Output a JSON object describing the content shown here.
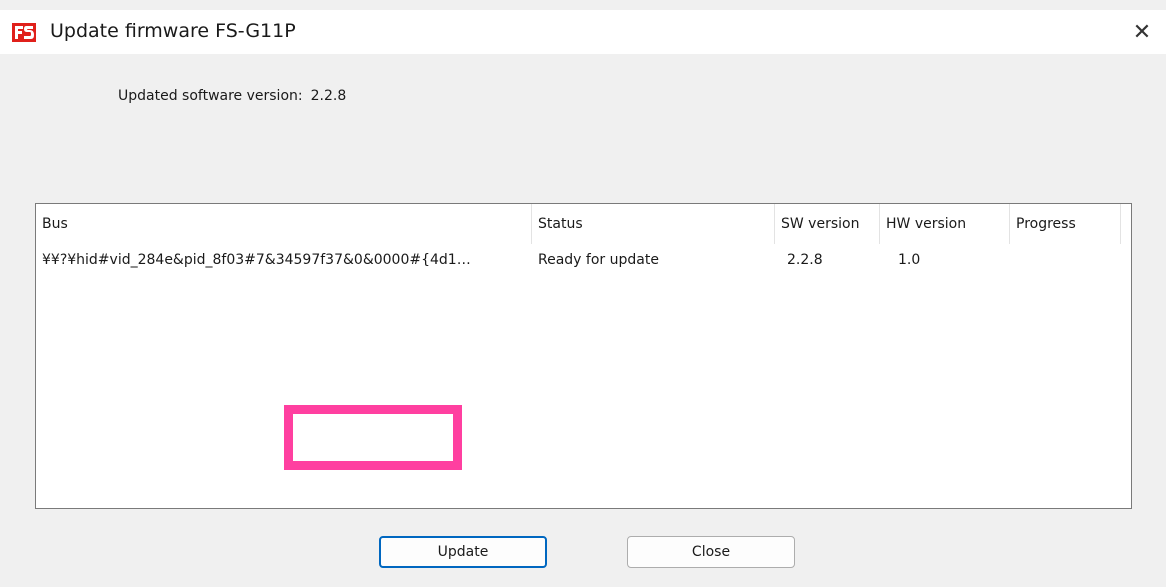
{
  "window": {
    "title": "Update firmware FS-G11P",
    "close_glyph": "✕",
    "app_icon": "fs-logo-icon"
  },
  "info": {
    "label": "Updated software version:",
    "value": "2.2.8"
  },
  "list": {
    "columns": [
      "Bus",
      "Status",
      "SW version",
      "HW version",
      "Progress"
    ],
    "rows": [
      {
        "bus": "¥¥?¥hid#vid_284e&pid_8f03#7&34597f37&0&0000#{4d1…",
        "status": "Ready for update",
        "sw_version": "2.2.8",
        "hw_version": "1.0",
        "progress": ""
      }
    ]
  },
  "buttons": {
    "update": "Update",
    "close": "Close"
  },
  "colors": {
    "highlight": "#ff3fa0",
    "default_button_border": "#0067c0",
    "logo_red": "#e0201b"
  }
}
